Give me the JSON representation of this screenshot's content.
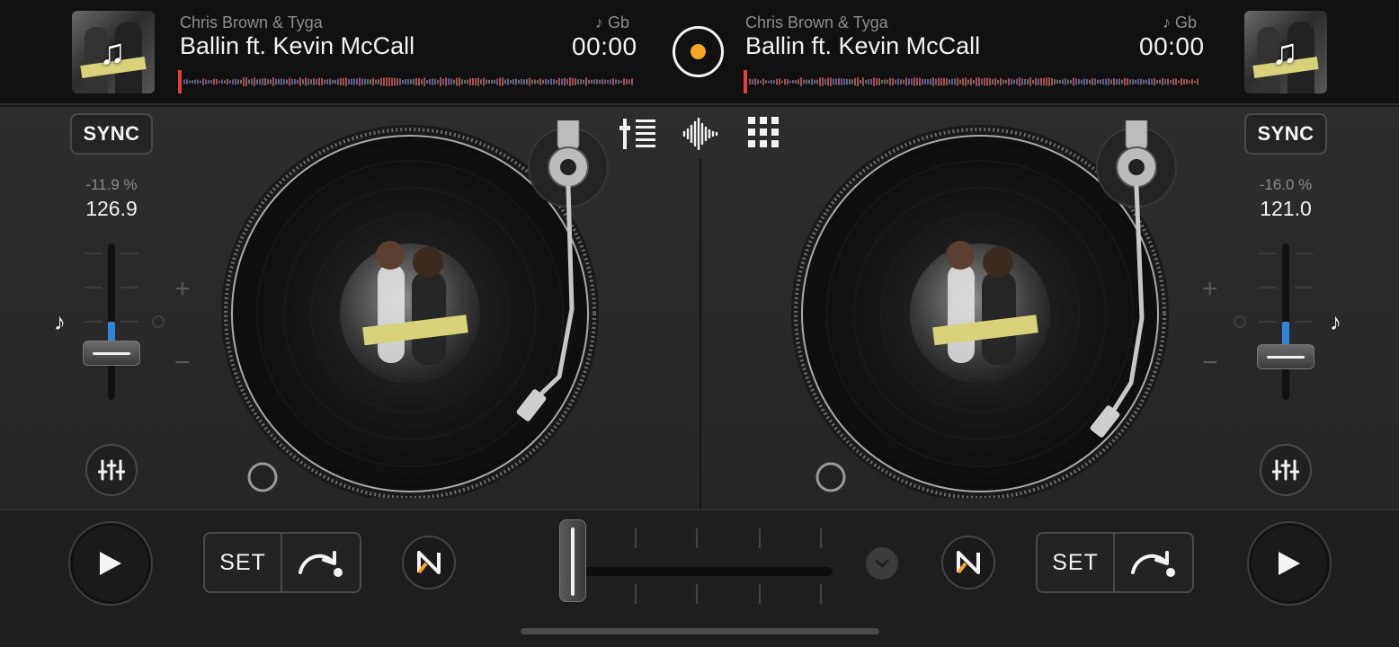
{
  "recorder": {
    "icon": "record-icon"
  },
  "decks": {
    "left": {
      "artist": "Chris Brown & Tyga",
      "title": "Ballin ft. Kevin McCall",
      "key": "♪ Gb",
      "time": "00:00",
      "sync_label": "SYNC",
      "pitch_percent": "-11.9 %",
      "bpm": "126.9",
      "pitch_level": 0.4,
      "cue_label": "SET",
      "plus": "+",
      "minus": "−",
      "music_note": "♪"
    },
    "right": {
      "artist": "Chris Brown & Tyga",
      "title": "Ballin ft. Kevin McCall",
      "key": "♪ Gb",
      "time": "00:00",
      "sync_label": "SYNC",
      "pitch_percent": "-16.0 %",
      "bpm": "121.0",
      "pitch_level": 0.45,
      "cue_label": "SET",
      "plus": "+",
      "minus": "−",
      "music_note": "♪"
    }
  },
  "center_modes": [
    "mixer-icon",
    "waveform-icon",
    "pads-grid-icon"
  ],
  "crossfader": {
    "position": 0.0
  },
  "colors": {
    "accent": "#f5a623",
    "pitch": "#2f86d9",
    "waveform": "#c05a5a"
  }
}
